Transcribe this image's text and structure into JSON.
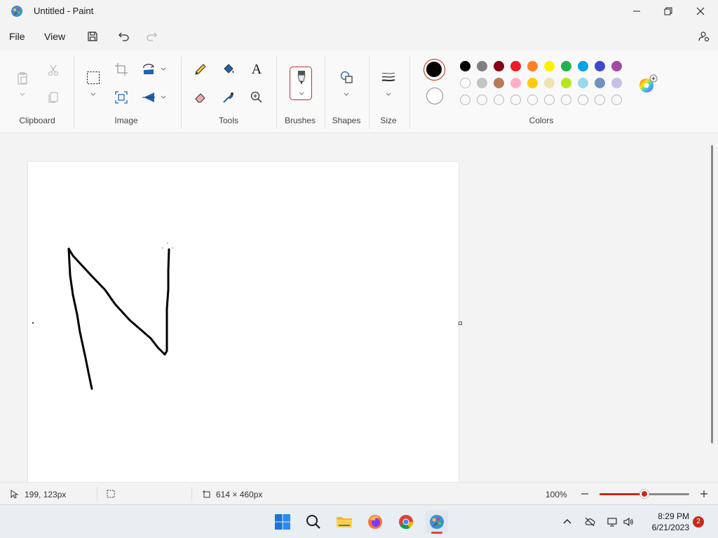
{
  "window": {
    "title": "Untitled - Paint"
  },
  "menu": {
    "file": "File",
    "view": "View"
  },
  "ribbon": {
    "groups": {
      "clipboard": "Clipboard",
      "image": "Image",
      "tools": "Tools",
      "brushes": "Brushes",
      "shapes": "Shapes",
      "size": "Size",
      "colors": "Colors"
    },
    "text_tool_glyph": "A",
    "primary_color": "#000000",
    "secondary_color": "#ffffff",
    "palette_row1": [
      "#000000",
      "#7f7f7f",
      "#880015",
      "#ed1c24",
      "#ff7f27",
      "#fff200",
      "#22b14c",
      "#00a2e8",
      "#3f48cc",
      "#a349a4"
    ],
    "palette_row2": [
      "#ffffff",
      "#c3c3c3",
      "#b97a57",
      "#ffaec9",
      "#ffc90e",
      "#efe4b0",
      "#b5e61d",
      "#99d9ea",
      "#7092be",
      "#c8bfe7"
    ],
    "palette_row3_empty_count": 10
  },
  "status": {
    "cursor_position": "199, 123px",
    "canvas_size": "614 × 460px",
    "zoom": "100%",
    "zoom_level": 0.5
  },
  "taskbar": {
    "time": "8:29 PM",
    "date": "6/21/2023",
    "notification_count": "2"
  },
  "colors": {
    "accent": "#c42b1c"
  }
}
